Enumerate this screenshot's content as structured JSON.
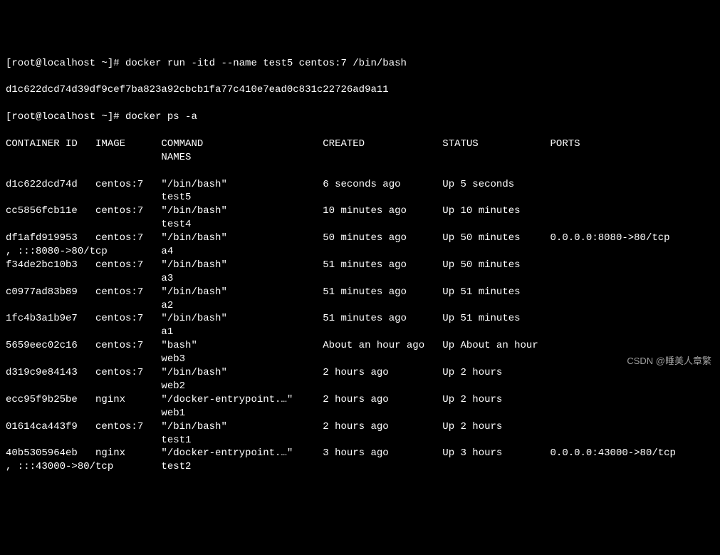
{
  "prompt1": {
    "user_host": "[root@localhost ~]# ",
    "command": "docker run -itd --name test5 centos:7 /bin/bash"
  },
  "run_output": "d1c622dcd74d39df9cef7ba823a92cbcb1fa77c410e7ead0c831c22726ad9a11",
  "prompt2": {
    "user_host": "[root@localhost ~]# ",
    "command": "docker ps -a"
  },
  "headers": {
    "container_id": "CONTAINER ID",
    "image": "IMAGE",
    "command": "COMMAND",
    "created": "CREATED",
    "status": "STATUS",
    "ports": "PORTS"
  },
  "headers2": {
    "names": "NAMES"
  },
  "rows": [
    {
      "id": "d1c622dcd74d",
      "image": "centos:7",
      "command": "\"/bin/bash\"",
      "created": "6 seconds ago",
      "status": "Up 5 seconds",
      "ports": "",
      "name": "test5",
      "wrap": ""
    },
    {
      "id": "cc5856fcb11e",
      "image": "centos:7",
      "command": "\"/bin/bash\"",
      "created": "10 minutes ago",
      "status": "Up 10 minutes",
      "ports": "",
      "name": "test4",
      "wrap": ""
    },
    {
      "id": "df1afd919953",
      "image": "centos:7",
      "command": "\"/bin/bash\"",
      "created": "50 minutes ago",
      "status": "Up 50 minutes",
      "ports": "0.0.0.0:8080->80/tcp",
      "name": "a4",
      "wrap": ", :::8080->80/tcp   "
    },
    {
      "id": "f34de2bc10b3",
      "image": "centos:7",
      "command": "\"/bin/bash\"",
      "created": "51 minutes ago",
      "status": "Up 50 minutes",
      "ports": "",
      "name": "a3",
      "wrap": ""
    },
    {
      "id": "c0977ad83b89",
      "image": "centos:7",
      "command": "\"/bin/bash\"",
      "created": "51 minutes ago",
      "status": "Up 51 minutes",
      "ports": "",
      "name": "a2",
      "wrap": ""
    },
    {
      "id": "1fc4b3a1b9e7",
      "image": "centos:7",
      "command": "\"/bin/bash\"",
      "created": "51 minutes ago",
      "status": "Up 51 minutes",
      "ports": "",
      "name": "a1",
      "wrap": ""
    },
    {
      "id": "5659eec02c16",
      "image": "centos:7",
      "command": "\"bash\"",
      "created": "About an hour ago",
      "status": "Up About an hour",
      "ports": "",
      "name": "web3",
      "wrap": ""
    },
    {
      "id": "d319c9e84143",
      "image": "centos:7",
      "command": "\"/bin/bash\"",
      "created": "2 hours ago",
      "status": "Up 2 hours",
      "ports": "",
      "name": "web2",
      "wrap": ""
    },
    {
      "id": "ecc95f9b25be",
      "image": "nginx",
      "command": "\"/docker-entrypoint.…\"",
      "created": "2 hours ago",
      "status": "Up 2 hours",
      "ports": "",
      "name": "web1",
      "wrap": ""
    },
    {
      "id": "01614ca443f9",
      "image": "centos:7",
      "command": "\"/bin/bash\"",
      "created": "2 hours ago",
      "status": "Up 2 hours",
      "ports": "",
      "name": "test1",
      "wrap": ""
    },
    {
      "id": "40b5305964eb",
      "image": "nginx",
      "command": "\"/docker-entrypoint.…\"",
      "created": "3 hours ago",
      "status": "Up 3 hours",
      "ports": "0.0.0.0:43000->80/tcp",
      "name": "test2",
      "wrap": ", :::43000->80/tcp  "
    }
  ],
  "watermark": "CSDN @睡美人章繁"
}
